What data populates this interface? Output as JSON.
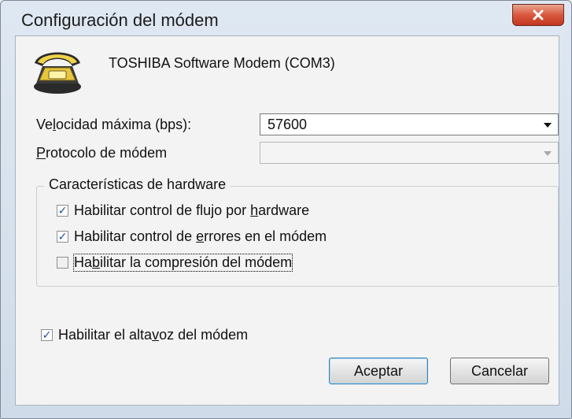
{
  "window": {
    "title": "Configuración del módem",
    "close_icon": "close-x"
  },
  "header": {
    "icon": "telephone-modem-icon",
    "device_name": "TOSHIBA Software Modem (COM3)"
  },
  "speed": {
    "label": "Velocidad máxima (bps):",
    "value": "57600"
  },
  "protocol": {
    "label": "Protocolo de módem",
    "value": "",
    "enabled": false
  },
  "hardware": {
    "title": "Características de hardware",
    "options": [
      {
        "label": "Habilitar control de flujo por hardware",
        "checked": true
      },
      {
        "label": "Habilitar control de errores en el módem",
        "checked": true
      },
      {
        "label": "Habilitar la compresión del módem",
        "checked": false
      }
    ]
  },
  "speaker": {
    "label": "Habilitar el altavoz del módem",
    "checked": true
  },
  "buttons": {
    "ok": "Aceptar",
    "cancel": "Cancelar"
  },
  "colors": {
    "accent": "#3c7fb1",
    "close": "#d9573e",
    "check": "#2b50a8"
  }
}
